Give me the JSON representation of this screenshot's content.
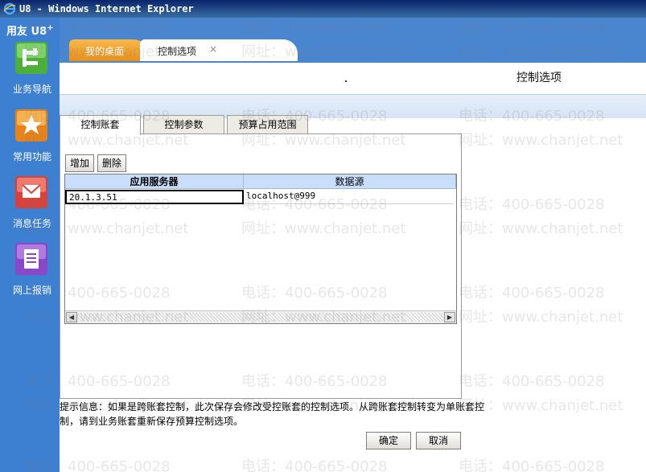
{
  "window": {
    "title": "U8 - Windows Internet Explorer"
  },
  "brand": {
    "name": "用友 U8",
    "sup": "+"
  },
  "sidebar": {
    "items": [
      {
        "label": "业务导航",
        "icon": "business-nav-icon",
        "color": "#4caf3a"
      },
      {
        "label": "常用功能",
        "icon": "star-icon",
        "color": "#e8821a"
      },
      {
        "label": "消息任务",
        "icon": "mail-icon",
        "color": "#d8423a"
      },
      {
        "label": "网上报销",
        "icon": "document-icon",
        "color": "#8a48c8"
      }
    ]
  },
  "page_tabs": [
    {
      "label": "我的桌面"
    },
    {
      "label": "控制选项",
      "close": "×"
    }
  ],
  "header": {
    "title": "控制选项"
  },
  "inner_tabs": [
    {
      "label": "控制账套"
    },
    {
      "label": "控制参数"
    },
    {
      "label": "预算占用范围"
    }
  ],
  "toolbar": {
    "add_label": "增加",
    "delete_label": "删除"
  },
  "grid": {
    "columns": [
      "应用服务器",
      "数据源"
    ],
    "rows": [
      [
        "20.1.3.51",
        "localhost@999"
      ]
    ]
  },
  "hint": {
    "text": "提示信息：如果是跨账套控制，此次保存会修改受控账套的控制选项。从跨账套控制转变为单账套控制，请到业务账套重新保存预算控制选项。"
  },
  "buttons": {
    "ok_label": "确定",
    "cancel_label": "取消"
  },
  "watermark": {
    "phone": "电话：400-665-0028",
    "site": "网址：www.chanjet.net"
  },
  "colors": {
    "sidebar": "#3d7fd1",
    "tab_active": "#f8b84a",
    "grid_header": "#c9defb"
  }
}
